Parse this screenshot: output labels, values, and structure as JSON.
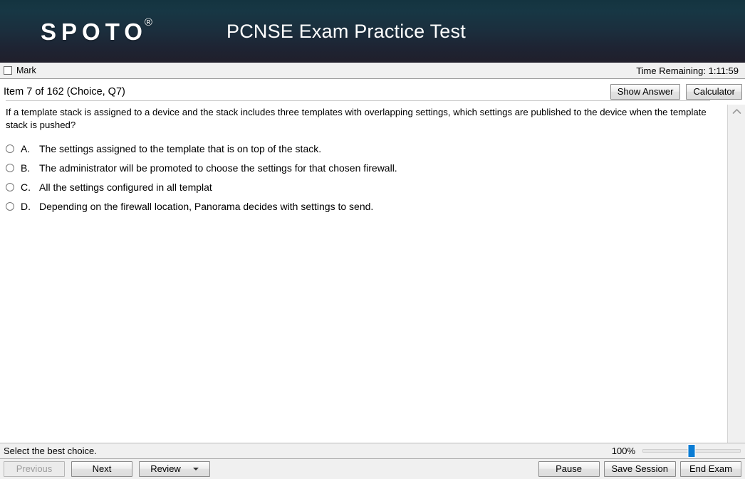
{
  "header": {
    "logo_text": "SPOTO",
    "logo_registered": "®",
    "title": "PCNSE Exam Practice Test"
  },
  "markbar": {
    "mark_label": "Mark",
    "timer_text": "Time Remaining: 1:11:59"
  },
  "item": {
    "label": "Item 7 of 162 (Choice, Q7)",
    "show_answer_label": "Show Answer",
    "calculator_label": "Calculator"
  },
  "question": {
    "text": "If a template stack is assigned to a device and the stack includes three templates with overlapping settings, which settings are published to the device when the template stack is pushed?",
    "choices": [
      {
        "letter": "A.",
        "text": "The settings assigned to the template that is on top of the stack."
      },
      {
        "letter": "B.",
        "text": "The administrator will be promoted to choose the settings for that chosen firewall."
      },
      {
        "letter": "C.",
        "text": "All the settings configured in all templat"
      },
      {
        "letter": "D.",
        "text": "Depending on the firewall location, Panorama decides with settings to send."
      }
    ]
  },
  "statusbar": {
    "hint": "Select the best choice.",
    "zoom_percent": "100%"
  },
  "toolbar": {
    "previous_label": "Previous",
    "next_label": "Next",
    "review_label": "Review",
    "pause_label": "Pause",
    "save_session_label": "Save Session",
    "end_exam_label": "End Exam"
  },
  "colors": {
    "header_top": "#143440",
    "header_bottom": "#201f2b",
    "slider_thumb": "#0a7cd4",
    "chrome": "#f0f0f0"
  }
}
